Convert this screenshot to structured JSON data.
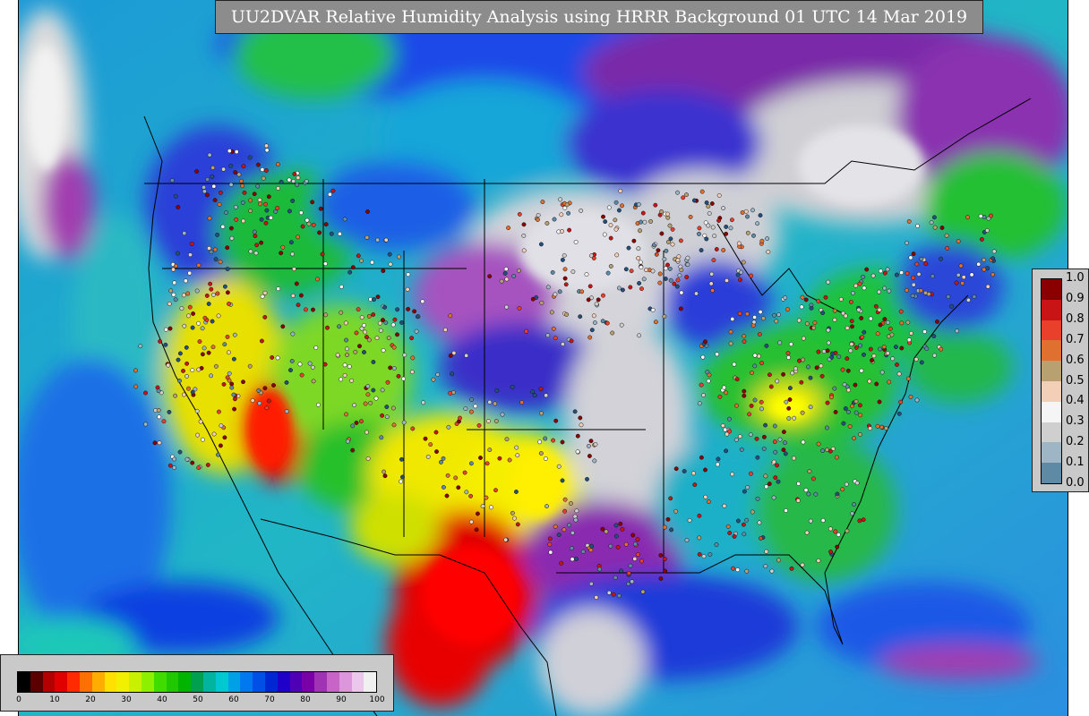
{
  "title": "UU2DVAR Relative Humidity Analysis using HRRR Background 01 UTC 14 Mar 2019",
  "icons": [
    "station-obs-marker"
  ],
  "colors": {
    "ocean_low": "#1a8fd8",
    "ocean_mid": "#1fb8c8",
    "dry_red": "#e00000",
    "yellow": "#f4e900",
    "green": "#2cc82c",
    "blue": "#1e46e6",
    "purple": "#7a2aa8",
    "moist_white": "#d6d6d6"
  },
  "station_legend": {
    "labels": [
      "1.0",
      "0.9",
      "0.8",
      "0.7",
      "0.6",
      "0.5",
      "0.4",
      "0.3",
      "0.2",
      "0.1",
      "0.0"
    ],
    "colors": [
      "#8a0000",
      "#c81414",
      "#e8402a",
      "#e07030",
      "#b8a070",
      "#f3cfb8",
      "#f5f5f5",
      "#cfcfcf",
      "#9db5c4",
      "#5e8aa6",
      "#244f7d"
    ]
  },
  "scale_legend": {
    "ticks": [
      "0",
      "10",
      "20",
      "30",
      "40",
      "50",
      "60",
      "70",
      "80",
      "90",
      "100"
    ],
    "colors": [
      "#000000",
      "#5a0000",
      "#b40000",
      "#e00000",
      "#ff2a00",
      "#ff7000",
      "#ffae00",
      "#ffe000",
      "#f0f000",
      "#c8f000",
      "#8cf000",
      "#40dc00",
      "#20c800",
      "#00b400",
      "#00a050",
      "#00b4a0",
      "#00c8d2",
      "#00a0e6",
      "#0078f0",
      "#0050e6",
      "#0028d2",
      "#1e00c8",
      "#5000b4",
      "#7a00a8",
      "#a032b4",
      "#c864c8",
      "#dc96dc",
      "#ebc8eb",
      "#f0f0f0"
    ]
  }
}
